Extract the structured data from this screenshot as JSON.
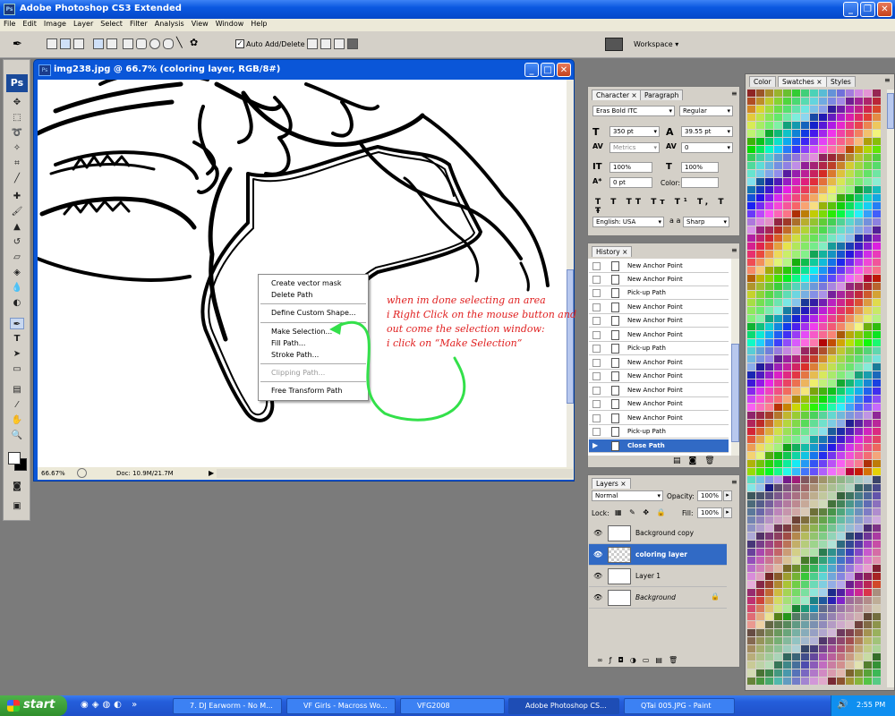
{
  "window": {
    "title": "Adobe Photoshop CS3 Extended",
    "ps_badge": "Ps"
  },
  "menu": [
    "File",
    "Edit",
    "Image",
    "Layer",
    "Select",
    "Filter",
    "Analysis",
    "View",
    "Window",
    "Help"
  ],
  "options": {
    "auto_add_delete": "Auto Add/Delete",
    "checked": "✓",
    "workspace": "Workspace ▾"
  },
  "tools": {
    "logo": "Ps"
  },
  "document": {
    "title": "img238.jpg @ 66.7% (coloring layer, RGB/8#)",
    "zoom": "66.67%",
    "doc_size": "Doc: 10.9M/21.7M"
  },
  "context_menu": {
    "items": [
      "Create vector mask",
      "Delete Path",
      "Define Custom Shape...",
      "Make Selection...",
      "Fill Path...",
      "Stroke Path...",
      "Clipping Path...",
      "Free Transform Path"
    ],
    "disabled": "Clipping Path..."
  },
  "annotation": "when im done selecting an area\ni Right Click on the mouse button and\nout come the selection window:\ni click on “Make Selection”",
  "character": {
    "tabs": [
      "Character",
      "Paragraph"
    ],
    "font": "Eras Bold ITC",
    "style": "Regular",
    "size": "350 pt",
    "leading": "39.55 pt",
    "kerning": "Metrics",
    "tracking": "0",
    "vscale": "100%",
    "hscale": "100%",
    "baseline": "0 pt",
    "color_label": "Color:",
    "language": "English: USA",
    "aa_label": "a a",
    "antialias": "Sharp",
    "type_buttons": [
      "T",
      "T",
      "TT",
      "Tт",
      "T¹",
      "T,",
      "T",
      "Ŧ"
    ]
  },
  "history": {
    "tab": "History",
    "items": [
      "New Anchor Point",
      "New Anchor Point",
      "Pick-up Path",
      "New Anchor Point",
      "New Anchor Point",
      "New Anchor Point",
      "Pick-up Path",
      "New Anchor Point",
      "New Anchor Point",
      "New Anchor Point",
      "New Anchor Point",
      "New Anchor Point",
      "Pick-up Path",
      "Close Path"
    ]
  },
  "layers": {
    "tab": "Layers",
    "blend": "Normal",
    "opacity_label": "Opacity:",
    "opacity": "100%",
    "lock_label": "Lock:",
    "fill_label": "Fill:",
    "fill": "100%",
    "items": [
      "Background copy",
      "coloring layer",
      "Layer 1",
      "Background"
    ]
  },
  "swatches": {
    "tabs": [
      "Color",
      "Swatches",
      "Styles"
    ]
  },
  "taskbar": {
    "start": "start",
    "tasks": [
      "7. DJ Earworm - No M...",
      "VF Girls - Macross Wo...",
      "VFG2008",
      "Adobe Photoshop CS...",
      "QTai 005.JPG - Paint"
    ],
    "clock": "2:55 PM"
  }
}
